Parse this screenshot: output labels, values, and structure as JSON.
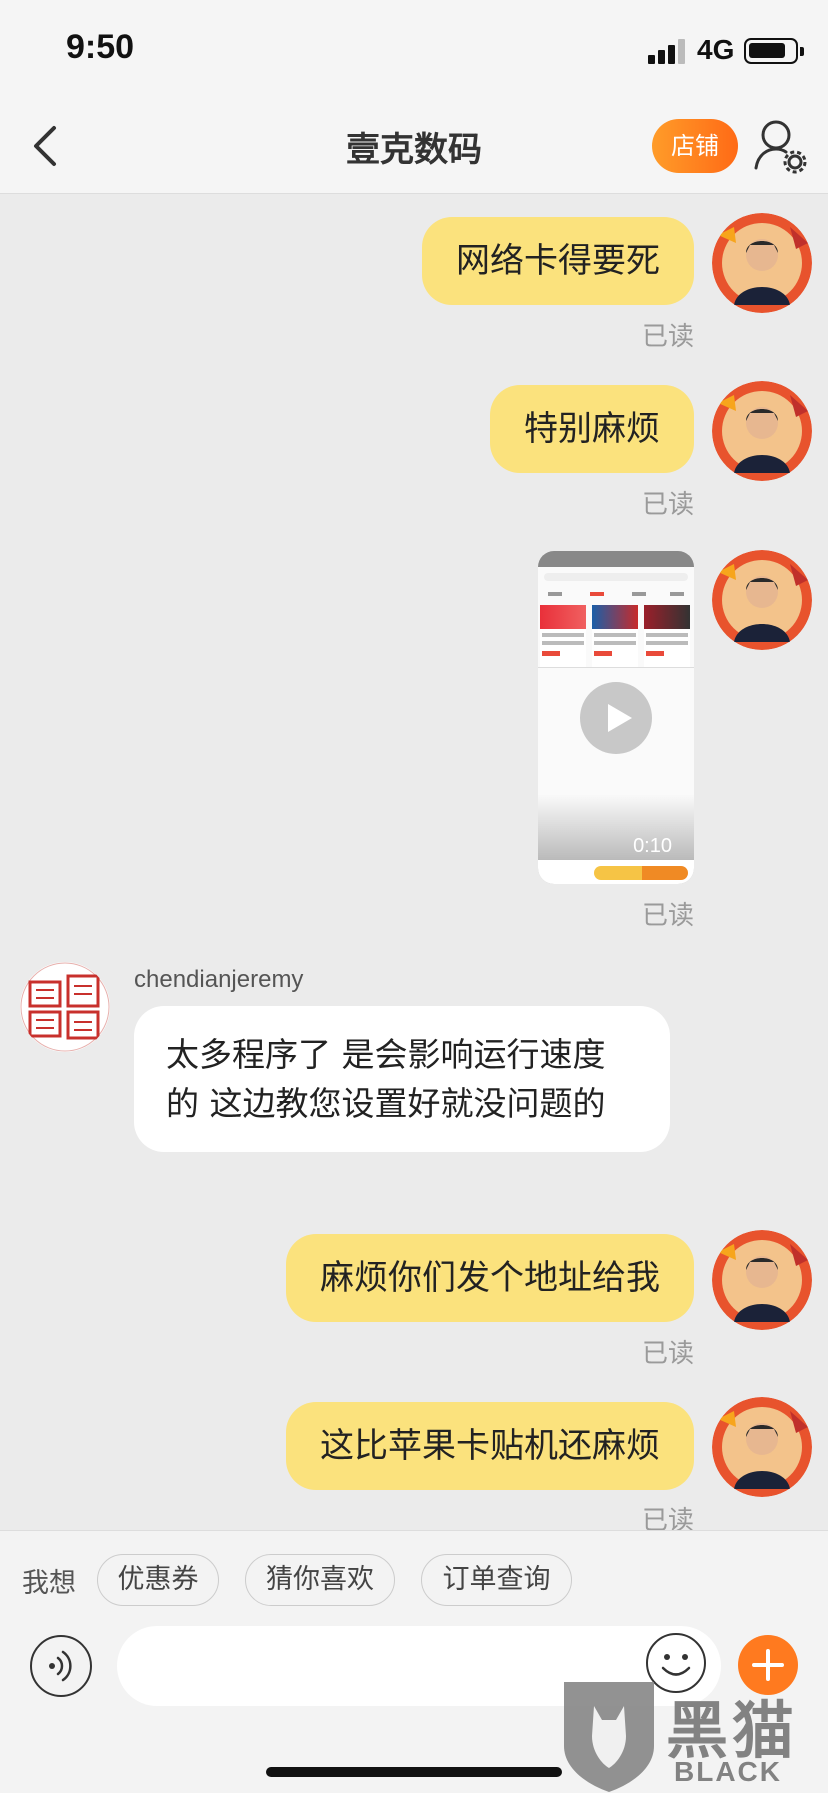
{
  "status_bar": {
    "time": "9:50",
    "network": "4G"
  },
  "nav": {
    "title": "壹克数码",
    "shop_label": "店铺"
  },
  "messages_out": [
    {
      "text": "网络卡得要死",
      "status": "已读"
    },
    {
      "text": "特别麻烦",
      "status": "已读"
    },
    {
      "text": "麻烦你们发个地址给我",
      "status": "已读"
    },
    {
      "text": "这比苹果卡贴机还麻烦",
      "status": "已读"
    }
  ],
  "video_message": {
    "duration": "0:10",
    "status": "已读"
  },
  "message_in": {
    "sender": "chendianjeremy",
    "text": "太多程序了 是会影响运行速度的 这边教您设置好就没问题的"
  },
  "quick_replies": {
    "label": "我想",
    "items": [
      "优惠券",
      "猜你喜欢",
      "订单查询"
    ]
  },
  "input": {
    "placeholder": ""
  },
  "watermark": {
    "cn": "黑猫",
    "en": "BLACK CAT"
  },
  "icons": [
    "back-icon",
    "user-settings-icon",
    "play-icon",
    "voice-icon",
    "emoji-icon",
    "plus-icon"
  ]
}
